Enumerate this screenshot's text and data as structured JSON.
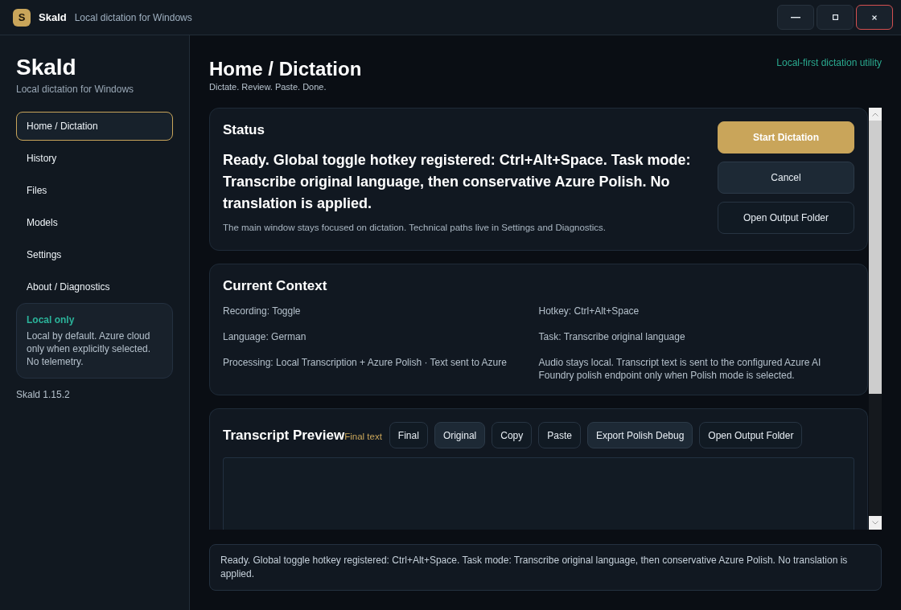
{
  "window": {
    "logo_letter": "S",
    "title": "Skald",
    "subtitle": "Local dictation for Windows"
  },
  "sidebar": {
    "title": "Skald",
    "subtitle": "Local dictation for Windows",
    "nav_items": [
      {
        "label": "Home / Dictation",
        "selected": true
      },
      {
        "label": "History",
        "selected": false
      },
      {
        "label": "Files",
        "selected": false
      },
      {
        "label": "Models",
        "selected": false
      },
      {
        "label": "Settings",
        "selected": false
      },
      {
        "label": "About / Diagnostics",
        "selected": false
      }
    ],
    "info_card": {
      "title": "Local only",
      "body": "Local by default. Azure cloud only when explicitly selected. No telemetry."
    },
    "version": "Skald 1.15.2"
  },
  "page": {
    "title": "Home / Dictation",
    "subtitle": "Dictate. Review. Paste. Done.",
    "tagline": "Local-first dictation utility"
  },
  "status_card": {
    "title": "Status",
    "message": "Ready. Global toggle hotkey registered: Ctrl+Alt+Space. Task mode: Transcribe original language, then conservative Azure Polish. No translation is applied.",
    "note": "The main window stays focused on dictation. Technical paths live in Settings and Diagnostics.",
    "buttons": [
      {
        "label": "Start Dictation",
        "kind": "primary"
      },
      {
        "label": "Cancel",
        "kind": "secondary"
      },
      {
        "label": "Open Output Folder",
        "kind": "outline"
      }
    ]
  },
  "context_card": {
    "title": "Current Context",
    "items": [
      "Recording: Toggle",
      "Hotkey: Ctrl+Alt+Space",
      "Language: German",
      "Task: Transcribe original language",
      "Processing: Local Transcription + Azure Polish · Text sent to Azure",
      "Audio stays local. Transcript text is sent to the configured Azure AI Foundry polish endpoint only when Polish mode is selected."
    ]
  },
  "transcript_card": {
    "title": "Transcript Preview",
    "view_label": "Final text",
    "buttons": [
      {
        "label": "Final",
        "kind": "outline"
      },
      {
        "label": "Original",
        "kind": "secondary"
      },
      {
        "label": "Copy",
        "kind": "outline"
      },
      {
        "label": "Paste",
        "kind": "outline"
      },
      {
        "label": "Export Polish Debug",
        "kind": "secondary"
      },
      {
        "label": "Open Output Folder",
        "kind": "outline"
      }
    ]
  },
  "status_bar": {
    "text": "Ready. Global toggle hotkey registered: Ctrl+Alt+Space. Task mode: Transcribe original language, then conservative Azure Polish. No translation is applied."
  }
}
